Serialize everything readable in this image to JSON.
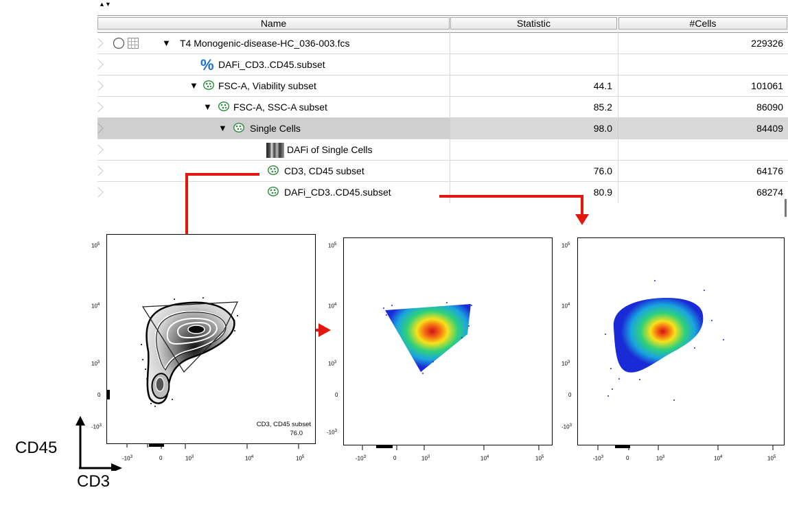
{
  "table": {
    "headers": {
      "name": "Name",
      "statistic": "Statistic",
      "cells": "#Cells"
    },
    "rows": [
      {
        "name": "T4  Monogenic-disease-HC_036-003.fcs",
        "statistic": "",
        "cells": "229326"
      },
      {
        "name": "DAFi_CD3..CD45.subset",
        "statistic": "",
        "cells": ""
      },
      {
        "name": "FSC-A, Viability subset",
        "statistic": "44.1",
        "cells": "101061"
      },
      {
        "name": "FSC-A, SSC-A subset",
        "statistic": "85.2",
        "cells": "86090"
      },
      {
        "name": "Single Cells",
        "statistic": "98.0",
        "cells": "84409"
      },
      {
        "name": "DAFi of Single Cells",
        "statistic": "",
        "cells": ""
      },
      {
        "name": "CD3, CD45 subset",
        "statistic": "76.0",
        "cells": "64176"
      },
      {
        "name": "DAFi_CD3..CD45.subset",
        "statistic": "80.9",
        "cells": "68274"
      }
    ],
    "selected_row": "Single Cells"
  },
  "plots": {
    "y_ticks": [
      "10",
      "10",
      "10",
      "0",
      "-10"
    ],
    "y_tick_exps": [
      "5",
      "4",
      "3",
      "",
      "3"
    ],
    "x_ticks": [
      "-10",
      "0",
      "10",
      "10",
      "10"
    ],
    "x_tick_exps": [
      "3",
      "",
      "3",
      "4",
      "5"
    ],
    "gate_label": "CD3, CD45 subset",
    "gate_value": "76.0"
  },
  "axes_legend": {
    "y": "CD45",
    "x": "CD3"
  },
  "colors": {
    "arrow": "#e3170f",
    "selected_row": "#cfcfcf"
  }
}
